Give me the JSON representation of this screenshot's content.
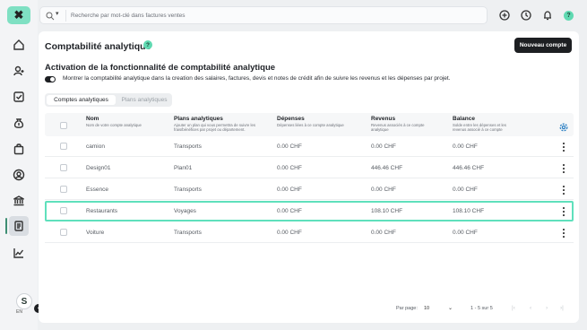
{
  "sidebar": {
    "logo_glyph": "✖",
    "items": [
      {
        "icon": "home-icon"
      },
      {
        "icon": "contacts-icon"
      },
      {
        "icon": "tasks-icon"
      },
      {
        "icon": "money-bag-icon"
      },
      {
        "icon": "shopping-bag-icon"
      },
      {
        "icon": "user-circle-icon"
      },
      {
        "icon": "bank-icon"
      },
      {
        "icon": "accounting-book-icon",
        "active": true
      },
      {
        "icon": "chart-line-icon"
      }
    ],
    "user": {
      "initials": "S",
      "badge": "44",
      "lang": "EN"
    }
  },
  "search": {
    "placeholder": "Recherche par mot-clé dans factures ventes"
  },
  "topbar_icons": [
    "add-circle-icon",
    "clock-icon",
    "bell-icon",
    "help-icon"
  ],
  "help_glyph": "?",
  "page": {
    "title": "Comptabilité analytique",
    "new_button": "Nouveau compte",
    "section_title": "Activation de la fonctionnalité de comptabilité analytique",
    "toggle_label": "Montrer la comptabilité analytique dans la creation des salaires, factures, devis et notes de crédit afin de suivre les revenus et les dépenses par projet.",
    "tabs": [
      "Comptes analytiques",
      "Plans analytiques"
    ]
  },
  "table": {
    "columns": [
      {
        "title": "Nom",
        "sub": "Nom de votre compte analytique"
      },
      {
        "title": "Plans analytiques",
        "sub": "Ajouter un plan qui vous permettra de suivre les frais/bénéfices par projet ou département."
      },
      {
        "title": "Dépenses",
        "sub": "Dépenses liées à ce compte analytique"
      },
      {
        "title": "Revenus",
        "sub": "Revenus associés à ce compte analytique"
      },
      {
        "title": "Balance",
        "sub": "Solde entre les dépenses et les revenus associé à ce compte"
      }
    ],
    "rows": [
      {
        "name": "camion",
        "plan": "Transports",
        "depenses": "0.00 CHF",
        "revenus": "0.00 CHF",
        "balance": "0.00 CHF"
      },
      {
        "name": "Design01",
        "plan": "Plan01",
        "depenses": "0.00 CHF",
        "revenus": "446.46 CHF",
        "balance": "446.46 CHF"
      },
      {
        "name": "Essence",
        "plan": "Transports",
        "depenses": "0.00 CHF",
        "revenus": "0.00 CHF",
        "balance": "0.00 CHF"
      },
      {
        "name": "Restaurants",
        "plan": "Voyages",
        "depenses": "0.00 CHF",
        "revenus": "108.10 CHF",
        "balance": "108.10 CHF",
        "highlighted": true
      },
      {
        "name": "Voiture",
        "plan": "Transports",
        "depenses": "0.00 CHF",
        "revenus": "0.00 CHF",
        "balance": "0.00 CHF"
      }
    ]
  },
  "pagination": {
    "per_page_label": "Par page:",
    "per_page_value": "10",
    "count": "1 - 5 sur 5",
    "buttons": [
      "|‹",
      "‹",
      "›",
      "›|"
    ]
  },
  "colors": {
    "accent": "#5fd9b1",
    "highlight_border": "#5fe0bc",
    "dark": "#1d1f22"
  }
}
